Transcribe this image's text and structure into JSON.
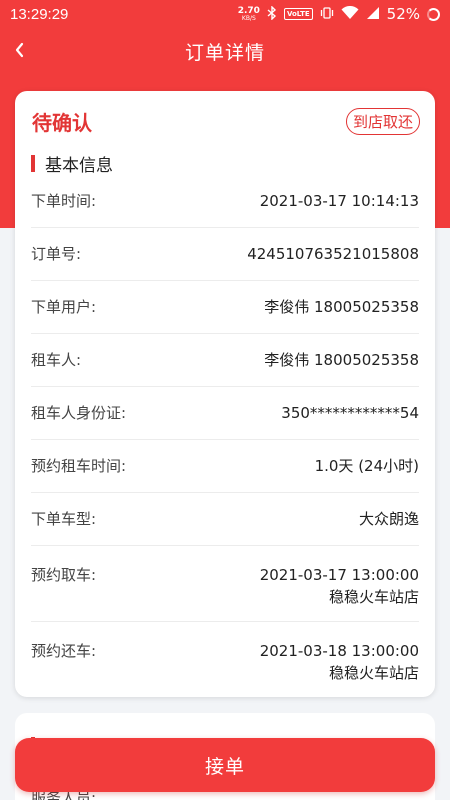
{
  "status_bar": {
    "time": "13:29:29",
    "net_speed_value": "2.70",
    "net_speed_unit": "KB/S",
    "volte": "VoLTE",
    "battery": "52%"
  },
  "header": {
    "title": "订单详情"
  },
  "order": {
    "status": "待确认",
    "pickup_badge": "到店取还",
    "section_title": "基本信息",
    "rows": [
      {
        "label": "下单时间:",
        "value": "2021-03-17 10:14:13"
      },
      {
        "label": "订单号:",
        "value": "424510763521015808"
      },
      {
        "label": "下单用户:",
        "value": "李俊伟  18005025358"
      },
      {
        "label": "租车人:",
        "value": "李俊伟  18005025358"
      },
      {
        "label": "租车人身份证:",
        "value": "350************54"
      },
      {
        "label": "预约租车时间:",
        "value": "1.0天 (24小时)"
      },
      {
        "label": "下单车型:",
        "value": "大众朗逸"
      },
      {
        "label": "预约取车:",
        "value": "2021-03-17 13:00:00",
        "value2": "稳稳火车站店"
      },
      {
        "label": "预约还车:",
        "value": "2021-03-18 13:00:00",
        "value2": "稳稳火车站店"
      }
    ]
  },
  "second_card": {
    "title": "",
    "row_label": "服务人员:"
  },
  "actions": {
    "accept_label": "接单"
  },
  "colors": {
    "brand_red": "#f23c3c",
    "accent_red": "#e23535"
  },
  "icons": {
    "back": "chevron-left-icon",
    "bluetooth": "bluetooth-icon",
    "vibrate": "vibrate-icon",
    "wifi": "wifi-icon",
    "signal": "signal-icon",
    "battery": "battery-icon"
  }
}
